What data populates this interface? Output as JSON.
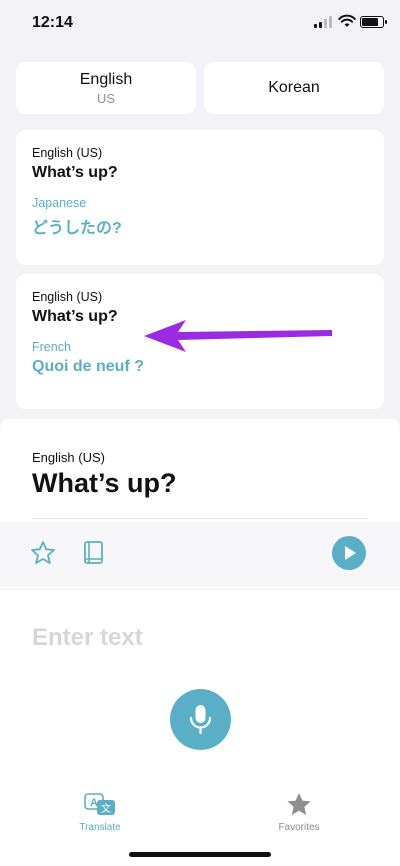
{
  "status_bar": {
    "time": "12:14"
  },
  "language_selector": {
    "source": {
      "name": "English",
      "region": "US"
    },
    "target": {
      "name": "Korean"
    }
  },
  "history": [
    {
      "source_lang": "English (US)",
      "source_text": "What’s up?",
      "target_lang": "Japanese",
      "target_text": "どうしたの?"
    },
    {
      "source_lang": "English (US)",
      "source_text": "What’s up?",
      "target_lang": "French",
      "target_text": "Quoi de neuf ?"
    }
  ],
  "current": {
    "source_lang": "English (US)",
    "source_text": "What’s up?"
  },
  "input": {
    "placeholder": "Enter text"
  },
  "tabs": [
    {
      "label": "Translate",
      "icon": "translate-icon",
      "active": true
    },
    {
      "label": "Favorites",
      "icon": "star-icon",
      "active": false
    }
  ],
  "colors": {
    "accent": "#5aafc6",
    "annotation_arrow": "#9a2be0",
    "inactive": "#8e8e93"
  }
}
